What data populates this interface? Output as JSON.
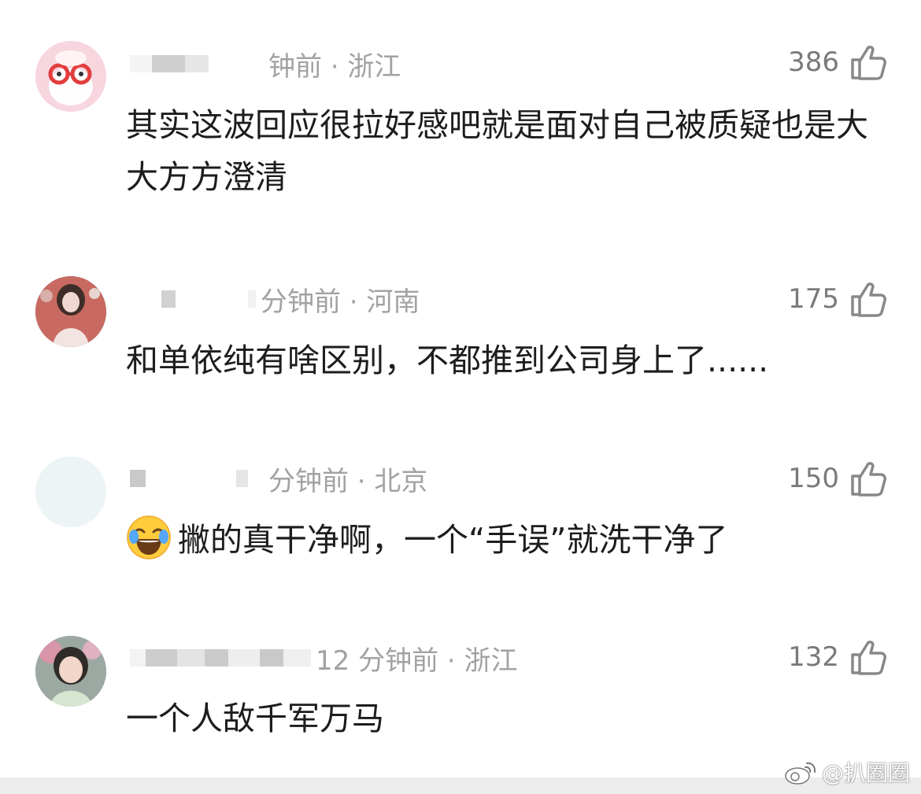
{
  "comments": [
    {
      "meta": "钟前 · 浙江",
      "likes": "386",
      "text": "其实这波回应很拉好感吧就是面对自己被质疑也是大大方方澄清"
    },
    {
      "meta": "分钟前 · 河南",
      "likes": "175",
      "text": "和单依纯有啥区别，不都推到公司身上了......"
    },
    {
      "meta": "分钟前 · 北京",
      "likes": "150",
      "emoji": "laughing-with-tears",
      "text": "撇的真干净啊，一个“手误”就洗干净了"
    },
    {
      "meta": "12 分钟前 · 浙江",
      "likes": "132",
      "text": "一个人敌千军万马"
    }
  ],
  "watermark": {
    "text": "@扒圈圈"
  },
  "colors": {
    "meta": "#a2a2a2",
    "likes": "#7a7a7a",
    "content": "#1d1d1d"
  },
  "icons": [
    "thumbs-up-icon",
    "laughing-emoji-icon",
    "weibo-logo-icon"
  ]
}
